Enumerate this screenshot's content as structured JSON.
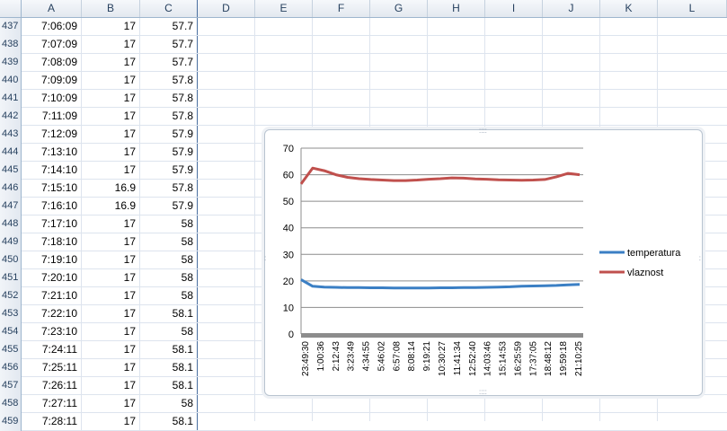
{
  "sheet": {
    "columns": [
      "A",
      "B",
      "C",
      "D",
      "E",
      "F",
      "G",
      "H",
      "I",
      "J",
      "K",
      "L"
    ],
    "rows": [
      {
        "n": "437",
        "a": "7:06:09",
        "b": "17",
        "c": "57.7"
      },
      {
        "n": "438",
        "a": "7:07:09",
        "b": "17",
        "c": "57.7"
      },
      {
        "n": "439",
        "a": "7:08:09",
        "b": "17",
        "c": "57.7"
      },
      {
        "n": "440",
        "a": "7:09:09",
        "b": "17",
        "c": "57.8"
      },
      {
        "n": "441",
        "a": "7:10:09",
        "b": "17",
        "c": "57.8"
      },
      {
        "n": "442",
        "a": "7:11:09",
        "b": "17",
        "c": "57.8"
      },
      {
        "n": "443",
        "a": "7:12:09",
        "b": "17",
        "c": "57.9"
      },
      {
        "n": "444",
        "a": "7:13:10",
        "b": "17",
        "c": "57.9"
      },
      {
        "n": "445",
        "a": "7:14:10",
        "b": "17",
        "c": "57.9"
      },
      {
        "n": "446",
        "a": "7:15:10",
        "b": "16.9",
        "c": "57.8"
      },
      {
        "n": "447",
        "a": "7:16:10",
        "b": "16.9",
        "c": "57.9"
      },
      {
        "n": "448",
        "a": "7:17:10",
        "b": "17",
        "c": "58"
      },
      {
        "n": "449",
        "a": "7:18:10",
        "b": "17",
        "c": "58"
      },
      {
        "n": "450",
        "a": "7:19:10",
        "b": "17",
        "c": "58"
      },
      {
        "n": "451",
        "a": "7:20:10",
        "b": "17",
        "c": "58"
      },
      {
        "n": "452",
        "a": "7:21:10",
        "b": "17",
        "c": "58"
      },
      {
        "n": "453",
        "a": "7:22:10",
        "b": "17",
        "c": "58.1"
      },
      {
        "n": "454",
        "a": "7:23:10",
        "b": "17",
        "c": "58"
      },
      {
        "n": "455",
        "a": "7:24:11",
        "b": "17",
        "c": "58.1"
      },
      {
        "n": "456",
        "a": "7:25:11",
        "b": "17",
        "c": "58.1"
      },
      {
        "n": "457",
        "a": "7:26:11",
        "b": "17",
        "c": "58.1"
      },
      {
        "n": "458",
        "a": "7:27:11",
        "b": "17",
        "c": "58"
      },
      {
        "n": "459",
        "a": "7:28:11",
        "b": "17",
        "c": "58.1"
      }
    ]
  },
  "chart_data": {
    "type": "line",
    "title": "",
    "ylim": [
      0,
      70
    ],
    "y_ticks": [
      "0",
      "10",
      "20",
      "30",
      "40",
      "50",
      "60",
      "70"
    ],
    "x_tick_labels": [
      "23:49:30",
      "1:00:36",
      "2:12:43",
      "3:23:49",
      "4:34:55",
      "5:46:02",
      "6:57:08",
      "8:08:14",
      "9:19:21",
      "10:30:27",
      "11:41:34",
      "12:52:40",
      "14:03:46",
      "15:14:53",
      "16:25:59",
      "17:37:05",
      "18:48:12",
      "19:59:18",
      "21:10:25"
    ],
    "grid": true,
    "legend": "right",
    "series": [
      {
        "name": "temperatura",
        "color": "#3b7fc4",
        "values": [
          20.5,
          18,
          17.7,
          17.6,
          17.5,
          17.5,
          17.4,
          17.4,
          17.3,
          17.3,
          17.3,
          17.3,
          17.4,
          17.4,
          17.5,
          17.5,
          17.6,
          17.7,
          17.8,
          18,
          18.1,
          18.2,
          18.3,
          18.5,
          18.7
        ]
      },
      {
        "name": "vlaznost",
        "color": "#c0504d",
        "values": [
          56.5,
          62.5,
          61.5,
          60,
          59,
          58.5,
          58.2,
          58,
          57.8,
          57.8,
          58,
          58.3,
          58.5,
          58.8,
          58.7,
          58.4,
          58.3,
          58.1,
          58,
          57.9,
          58,
          58.2,
          59.2,
          60.5,
          60
        ]
      }
    ]
  }
}
